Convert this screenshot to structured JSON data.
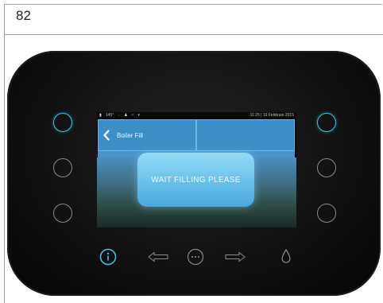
{
  "page": {
    "number": "82"
  },
  "screen": {
    "status": {
      "left_text": "145°",
      "right_text": "11:25 | 19 Febbraio 2015"
    },
    "title_tile": {
      "label": "Boiler Fill"
    },
    "popup": {
      "message": "WAIT FILLING PLEASE"
    }
  },
  "colors": {
    "accent": "#48c2e6",
    "tile": "#3d8ec7",
    "page_rule": "#6fb2d2"
  },
  "icons": {
    "info": "info-icon",
    "arrow_left": "arrow-left-icon",
    "menu": "dots-menu-icon",
    "arrow_right": "arrow-right-icon",
    "water": "water-drop-icon"
  }
}
